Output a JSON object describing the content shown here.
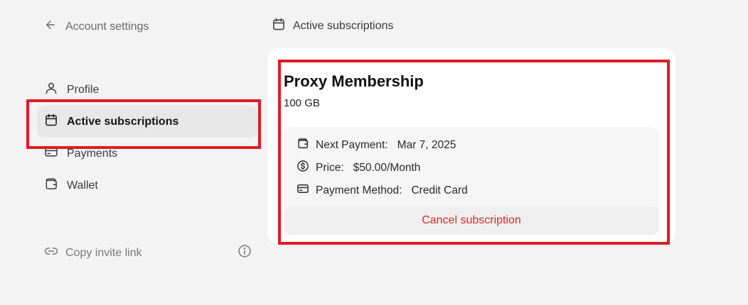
{
  "nav": {
    "back_label": "Account settings",
    "items": [
      {
        "label": "Profile",
        "icon": "user-icon"
      },
      {
        "label": "Active subscriptions",
        "icon": "calendar-icon",
        "active": true
      },
      {
        "label": "Payments",
        "icon": "credit-card-icon"
      },
      {
        "label": "Wallet",
        "icon": "wallet-icon"
      }
    ],
    "invite_label": "Copy invite link"
  },
  "section": {
    "title": "Active subscriptions"
  },
  "subscription": {
    "name": "Proxy Membership",
    "size": "100 GB",
    "next_payment_label": "Next Payment:",
    "next_payment_value": "Mar 7, 2025",
    "price_label": "Price:",
    "price_value": "$50.00/Month",
    "method_label": "Payment Method:",
    "method_value": "Credit Card",
    "cancel_label": "Cancel subscription"
  },
  "colors": {
    "accent_red": "#e0262b",
    "highlight_red": "#e01b24",
    "background": "#f3f3f3",
    "active_bg": "#e7e7e7"
  }
}
